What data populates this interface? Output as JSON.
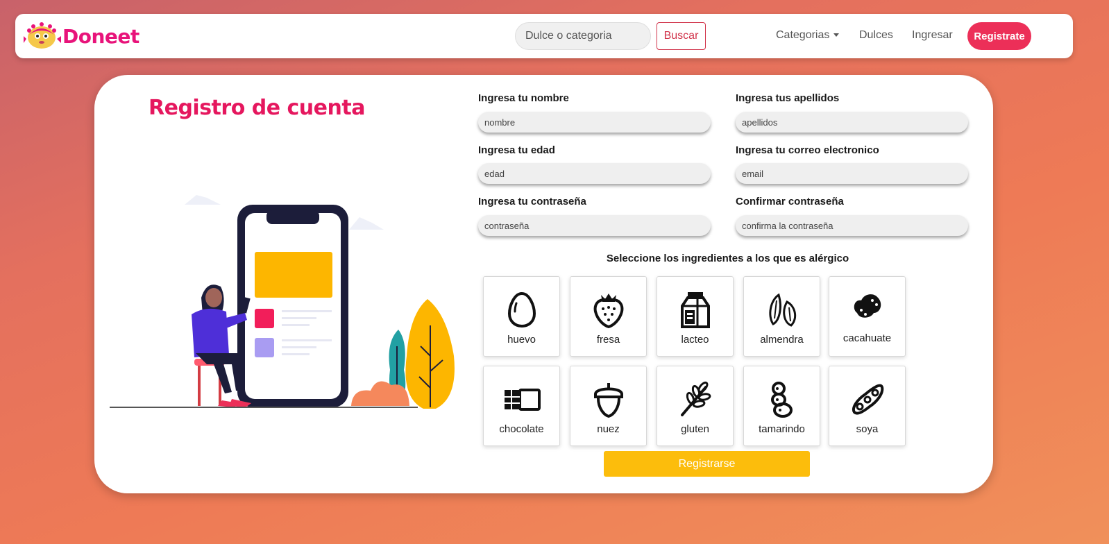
{
  "brand": {
    "name": "Doneet"
  },
  "nav": {
    "search_placeholder": "Dulce o categoria",
    "search_button": "Buscar",
    "links": [
      "Categorias",
      "Dulces",
      "Ingresar"
    ],
    "register": "Registrate"
  },
  "page": {
    "title": "Registro de cuenta"
  },
  "form": {
    "fields": [
      {
        "label": "Ingresa tu nombre",
        "placeholder": "nombre"
      },
      {
        "label": "Ingresa tus apellidos",
        "placeholder": "apellidos"
      },
      {
        "label": "Ingresa tu edad",
        "placeholder": "edad"
      },
      {
        "label": "Ingresa tu correo electronico",
        "placeholder": "email"
      },
      {
        "label": "Ingresa tu contraseña",
        "placeholder": "contraseña"
      },
      {
        "label": "Confirmar contraseña",
        "placeholder": "confirma la contraseña"
      }
    ],
    "allergy_title": "Seleccione los ingredientes a los que es alérgico",
    "ingredients": [
      {
        "label": "huevo",
        "icon": "egg-icon"
      },
      {
        "label": "fresa",
        "icon": "strawberry-icon"
      },
      {
        "label": "lacteo",
        "icon": "milk-carton-icon"
      },
      {
        "label": "almendra",
        "icon": "almond-icon"
      },
      {
        "label": "cacahuate",
        "icon": "peanut-icon"
      },
      {
        "label": "chocolate",
        "icon": "chocolate-bar-icon"
      },
      {
        "label": "nuez",
        "icon": "acorn-icon"
      },
      {
        "label": "gluten",
        "icon": "wheat-icon"
      },
      {
        "label": "tamarindo",
        "icon": "tamarind-icon"
      },
      {
        "label": "soya",
        "icon": "soybean-pod-icon"
      }
    ],
    "submit": "Registrarse"
  },
  "colors": {
    "brand": "#e8137a",
    "title": "#e5175e",
    "register_button": "#ec2f58",
    "search_button": "#d1334a",
    "submit_button": "#fcbd0c"
  }
}
